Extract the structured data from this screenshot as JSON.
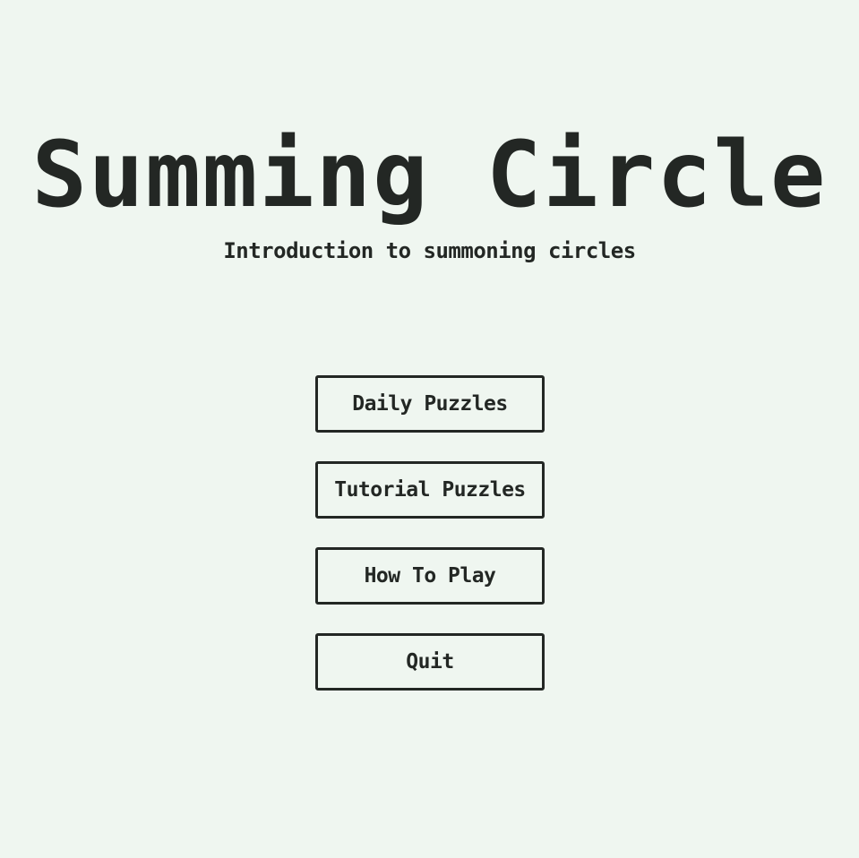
{
  "title": "Summing Circle",
  "subtitle": "Introduction to summoning circles",
  "menu": {
    "items": [
      {
        "label": "Daily Puzzles"
      },
      {
        "label": "Tutorial Puzzles"
      },
      {
        "label": "How To Play"
      },
      {
        "label": "Quit"
      }
    ]
  },
  "colors": {
    "background": "#eff6f0",
    "foreground": "#232724"
  }
}
